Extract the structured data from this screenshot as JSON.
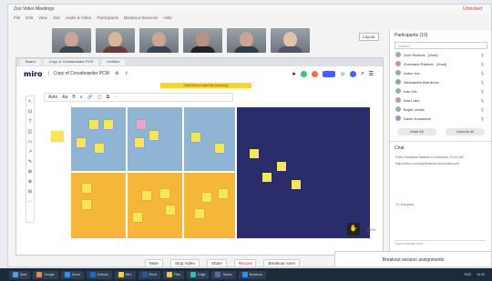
{
  "window": {
    "title": "Zoo Video Meetings",
    "menu": [
      "File",
      "Edit",
      "View",
      "Join",
      "Audio & Video",
      "Participants",
      "Breakout Sessions",
      "Help"
    ],
    "user_indicator": "Unlocked"
  },
  "video": {
    "layout_label": "Layout"
  },
  "browser": {
    "tabs": [
      "Board",
      "Copy of Crossboarder PCR",
      "Untitled"
    ]
  },
  "miro": {
    "logo": "miro",
    "board_title": "Copy of Crossboarder PCM",
    "banner": "Click here to start the workshop",
    "section_toolbar": [
      "Auto",
      "Aa",
      "B",
      "≡",
      "🔗",
      "▢",
      "⧉",
      "⋯"
    ],
    "left_tools": [
      "↖",
      "⊡",
      "T",
      "◱",
      "▭",
      "↗",
      "✎",
      "⊞",
      "⊕",
      "⊟",
      "⋯"
    ],
    "zoom": "100%"
  },
  "meeting_controls": [
    "Mute",
    "Stop Video",
    "Share",
    "Record",
    "Breakout room"
  ],
  "participants": {
    "title": "Participants (10)",
    "search_placeholder": "Search",
    "people": [
      {
        "name": "Zoro Radovic",
        "sub": "(Host)"
      },
      {
        "name": "Zvezdana Radovic",
        "sub": "(Host)"
      },
      {
        "name": "Antun Ivic",
        "sub": ""
      },
      {
        "name": "Aleksandra Brankovic",
        "sub": ""
      },
      {
        "name": "Ivan Ivic",
        "sub": ""
      },
      {
        "name": "Ana Lukic",
        "sub": ""
      },
      {
        "name": "Bojan Uredic",
        "sub": ""
      },
      {
        "name": "Darko Kovačević",
        "sub": ""
      }
    ],
    "mute_all": "Mute All",
    "unmute_all": "Unmute All"
  },
  "chat": {
    "title": "Chat",
    "messages": [
      "From Zvezdana Radovic to Everyone: 10:41 AM",
      "https://miro.com/app/board/cross-border-pcm"
    ],
    "to_label": "To: Everyone",
    "input_placeholder": "Type message here..."
  },
  "breakout": {
    "label": "Breakout session assignments"
  },
  "taskbar": {
    "items": [
      "Start",
      "Google",
      "Zoom",
      "Outlook",
      "Miro",
      "Word",
      "Files",
      "Edge",
      "Teams",
      "Breakout"
    ],
    "tray": [
      "ENG",
      "10:42"
    ]
  },
  "colors": {
    "miro_blue": "#4262ff",
    "section_blue": "#8fb4d4",
    "section_orange": "#f5b73a",
    "section_navy": "#2b2d6b",
    "sticky_yellow": "#f4e85a"
  }
}
